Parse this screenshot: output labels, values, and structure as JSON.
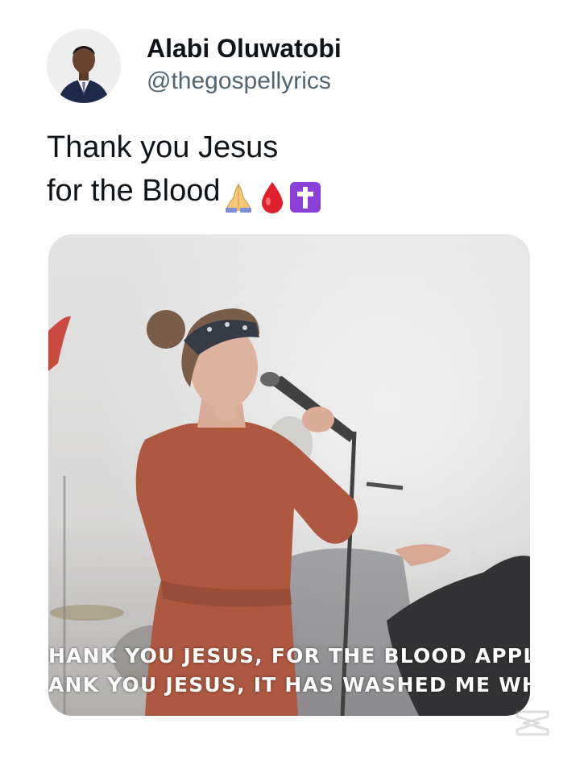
{
  "author": {
    "name": "Alabi Oluwatobi",
    "handle": "@thegospellyrics",
    "avatar_icon": "profile-photo"
  },
  "tweet": {
    "line1": "Thank you Jesus",
    "line2": "for the Blood",
    "emojis": [
      "folded-hands-icon",
      "blood-drop-icon",
      "latin-cross-icon"
    ]
  },
  "media": {
    "caption_line1": "HANK YOU JESUS, FOR THE BLOOD APPLIE",
    "caption_line2": "ANK YOU JESUS, IT HAS WASHED ME WH"
  },
  "watermark": {
    "icon": "capcut-logo-icon"
  },
  "colors": {
    "text_primary": "#0f1419",
    "text_secondary": "#536471",
    "drop_red": "#e0202f",
    "cross_purple": "#8a3fd6",
    "dress_rust": "#a8452a"
  }
}
